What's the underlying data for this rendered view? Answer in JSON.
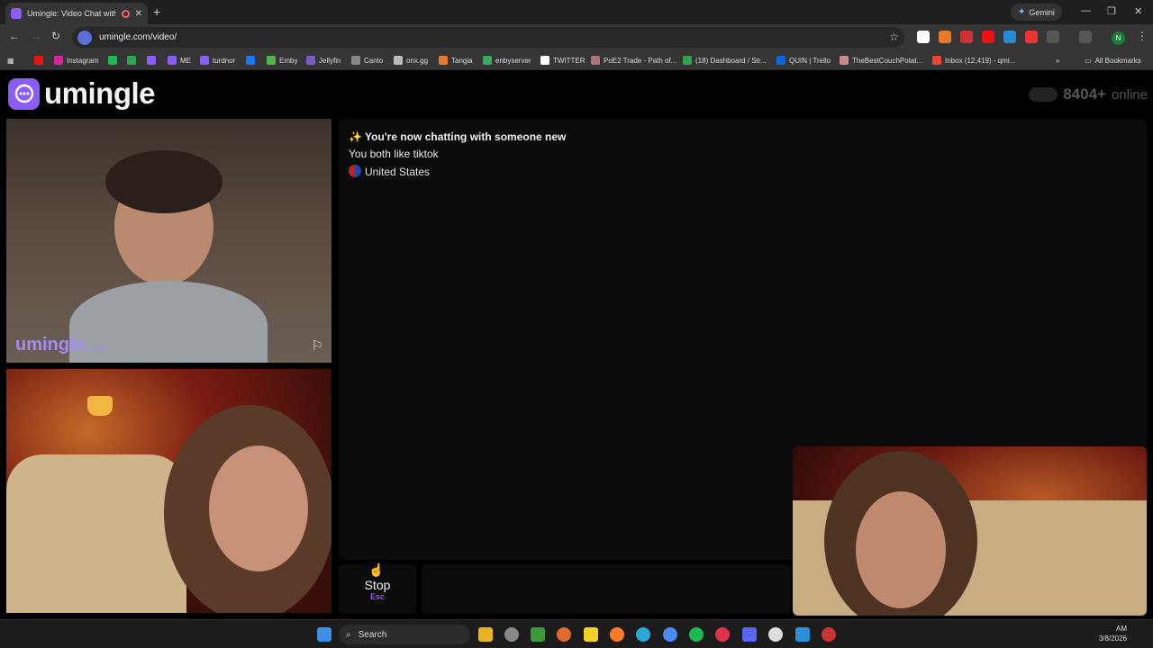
{
  "browser": {
    "tab_title": "Umingle: Video Chat with S",
    "tab_close": "✕",
    "new_tab": "+",
    "gemini_label": "Gemini",
    "url": "umingle.com/video/",
    "profile_initial": "N",
    "all_bookmarks": "All Bookmarks",
    "bookmarks": [
      {
        "label": "",
        "color": "#e11"
      },
      {
        "label": "Instagram",
        "color": "#d6249f"
      },
      {
        "label": "",
        "color": "#1db954"
      },
      {
        "label": "",
        "color": "#2ea44f"
      },
      {
        "label": "",
        "color": "#8b5cf6"
      },
      {
        "label": "ME",
        "color": "#8b5cf6"
      },
      {
        "label": "turdnor",
        "color": "#8b5cf6"
      },
      {
        "label": "",
        "color": "#1877f2"
      },
      {
        "label": "Emby",
        "color": "#52b54b"
      },
      {
        "label": "Jellyfin",
        "color": "#7a5cc7"
      },
      {
        "label": "Canto",
        "color": "#888"
      },
      {
        "label": "onx.gg",
        "color": "#bbb"
      },
      {
        "label": "Tangia",
        "color": "#e8782a"
      },
      {
        "label": "enbyserver",
        "color": "#3aaa5a"
      },
      {
        "label": "TWITTER",
        "color": "#fff"
      },
      {
        "label": "PoE2 Trade - Path of...",
        "color": "#a77"
      },
      {
        "label": "(18) Dashboard / Str...",
        "color": "#2ea44f"
      },
      {
        "label": "QUIN | Trello",
        "color": "#0c66e4"
      },
      {
        "label": "TheBestCouchPotat...",
        "color": "#c88"
      },
      {
        "label": "Inbox (12,419) - qmi...",
        "color": "#ea4335"
      }
    ]
  },
  "site": {
    "logo_text": "umingle",
    "online_count": "8404+",
    "online_label": "online"
  },
  "remote_video": {
    "watermark": "umingle",
    "watermark_domain": ".com"
  },
  "chat": {
    "headline": "✨ You're now chatting with someone new",
    "interest": "You both like tiktok",
    "country": "United States"
  },
  "controls": {
    "stop_label": "Stop",
    "stop_key": "Esc"
  },
  "taskbar": {
    "search_placeholder": "Search",
    "time": "AM",
    "date": "3/8/2026"
  }
}
